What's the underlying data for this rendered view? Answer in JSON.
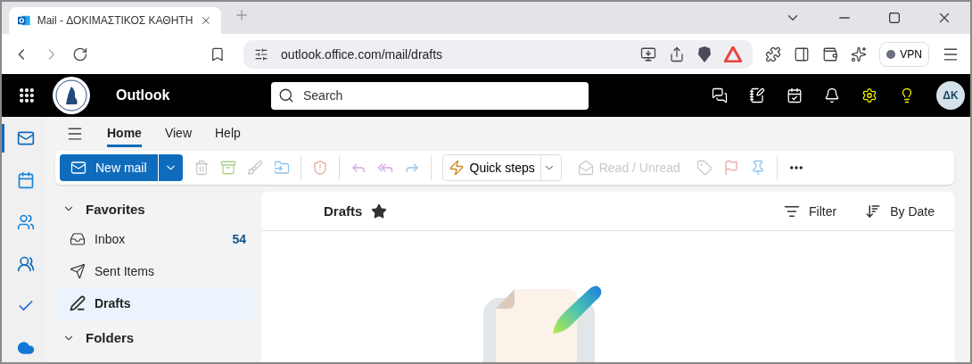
{
  "browser": {
    "tab": {
      "title": "Mail - ΔΟΚΙΜΑΣΤΙΚΟΣ ΚΑΘΗΤΗ"
    },
    "url": "outlook.office.com/mail/drafts",
    "vpn": "VPN"
  },
  "header": {
    "app": "Outlook",
    "search": {
      "placeholder": "Search"
    },
    "avatar": "ΔΚ"
  },
  "rail": [
    {
      "kind": "mail",
      "selected": true
    },
    {
      "kind": "calendar",
      "selected": false
    },
    {
      "kind": "people",
      "selected": false
    },
    {
      "kind": "groups",
      "selected": false
    },
    {
      "kind": "todo",
      "selected": false
    },
    {
      "kind": "cloud",
      "selected": false
    }
  ],
  "ribbon_tabs": [
    {
      "label": "Home",
      "selected": true
    },
    {
      "label": "View",
      "selected": false
    },
    {
      "label": "Help",
      "selected": false
    }
  ],
  "ribbon": {
    "new_mail": "New mail",
    "quick_steps": "Quick steps",
    "read_unread": {
      "label": "Read / Unread",
      "disabled": true
    }
  },
  "nav": [
    {
      "title": "Favorites",
      "expanded": true,
      "items": [
        {
          "kind": "inbox",
          "label": "Inbox",
          "count": "54",
          "selected": false
        },
        {
          "kind": "sent",
          "label": "Sent Items",
          "selected": false
        },
        {
          "kind": "drafts",
          "label": "Drafts",
          "selected": true
        }
      ]
    },
    {
      "title": "Folders",
      "expanded": true
    }
  ],
  "list": {
    "title": "Drafts",
    "filter": "Filter",
    "sort": "By Date"
  }
}
